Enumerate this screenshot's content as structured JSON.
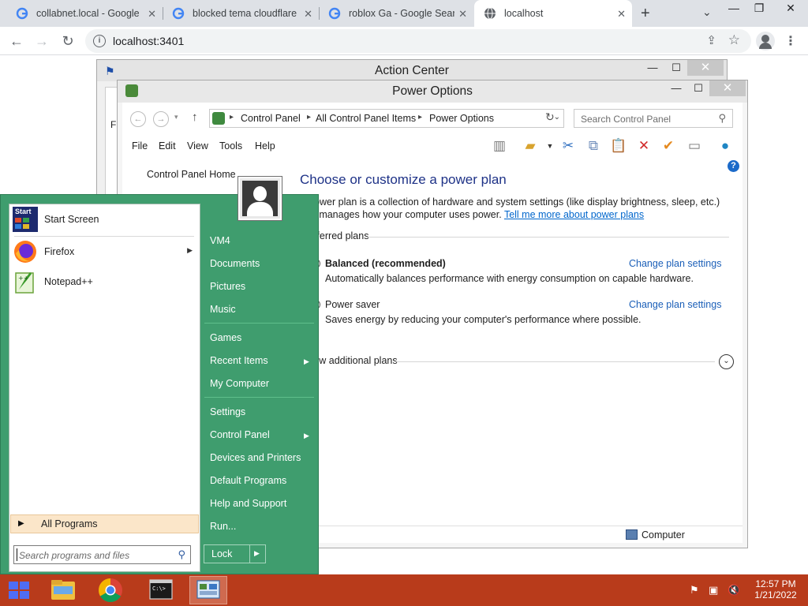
{
  "browser": {
    "tabs": [
      {
        "title": "collabnet.local - Google Search"
      },
      {
        "title": "blocked tema cloudflare - Google Search"
      },
      {
        "title": "roblox Ga - Google Search"
      },
      {
        "title": "localhost"
      }
    ],
    "url": "localhost:3401"
  },
  "action_center": {
    "title": "Action Center",
    "partial_text": "Fi"
  },
  "power_options": {
    "title": "Power Options",
    "breadcrumbs": [
      "Control Panel",
      "All Control Panel Items",
      "Power Options"
    ],
    "search_placeholder": "Search Control Panel",
    "menu": [
      "File",
      "Edit",
      "View",
      "Tools",
      "Help"
    ],
    "sidebar_home": "Control Panel Home",
    "heading": "Choose or customize a power plan",
    "description": "A power plan is a collection of hardware and system settings (like display brightness, sleep, etc.) that manages how your computer uses power.",
    "tell_more_link": "Tell me more about power plans",
    "section_label": "Preferred plans",
    "plans": [
      {
        "name": "Balanced (recommended)",
        "desc": "Automatically balances performance with energy consumption on capable hardware.",
        "link": "Change plan settings",
        "selected": true
      },
      {
        "name": "Power saver",
        "desc": "Saves energy by reducing your computer's performance where possible.",
        "link": "Change plan settings",
        "selected": false
      }
    ],
    "show_additional": "Show additional plans",
    "status_label": "Computer"
  },
  "start_menu": {
    "pinned": [
      {
        "label": "Start Screen",
        "icon": "start-screen-icon",
        "has_arrow": false
      },
      {
        "label": "Firefox",
        "icon": "firefox-icon",
        "has_arrow": true
      },
      {
        "label": "Notepad++",
        "icon": "notepad-plus-plus-icon",
        "has_arrow": false
      }
    ],
    "start_screen_icon_text": "Start",
    "all_programs": "All Programs",
    "search_placeholder": "Search programs and files",
    "right_items": [
      {
        "label": "VM4",
        "has_arrow": false
      },
      {
        "label": "Documents",
        "has_arrow": false
      },
      {
        "label": "Pictures",
        "has_arrow": false
      },
      {
        "label": "Music",
        "has_arrow": false
      },
      {
        "label": "Games",
        "has_arrow": false
      },
      {
        "label": "Recent Items",
        "has_arrow": true
      },
      {
        "label": "My Computer",
        "has_arrow": false
      },
      {
        "label": "Settings",
        "has_arrow": false
      },
      {
        "label": "Control Panel",
        "has_arrow": true
      },
      {
        "label": "Devices and Printers",
        "has_arrow": false
      },
      {
        "label": "Default Programs",
        "has_arrow": false
      },
      {
        "label": "Help and Support",
        "has_arrow": false
      },
      {
        "label": "Run...",
        "has_arrow": false
      }
    ],
    "lock_label": "Lock"
  },
  "taskbar": {
    "apps": [
      {
        "name": "file-explorer-icon"
      },
      {
        "name": "chrome-icon"
      },
      {
        "name": "command-prompt-icon"
      },
      {
        "name": "control-panel-icon"
      }
    ],
    "time": "12:57 PM",
    "date": "1/21/2022"
  },
  "colors": {
    "start_menu_green": "#3f9d6e",
    "taskbar_red": "#b83b1b",
    "link_blue": "#1b5fb8",
    "heading_blue": "#1e3287"
  }
}
